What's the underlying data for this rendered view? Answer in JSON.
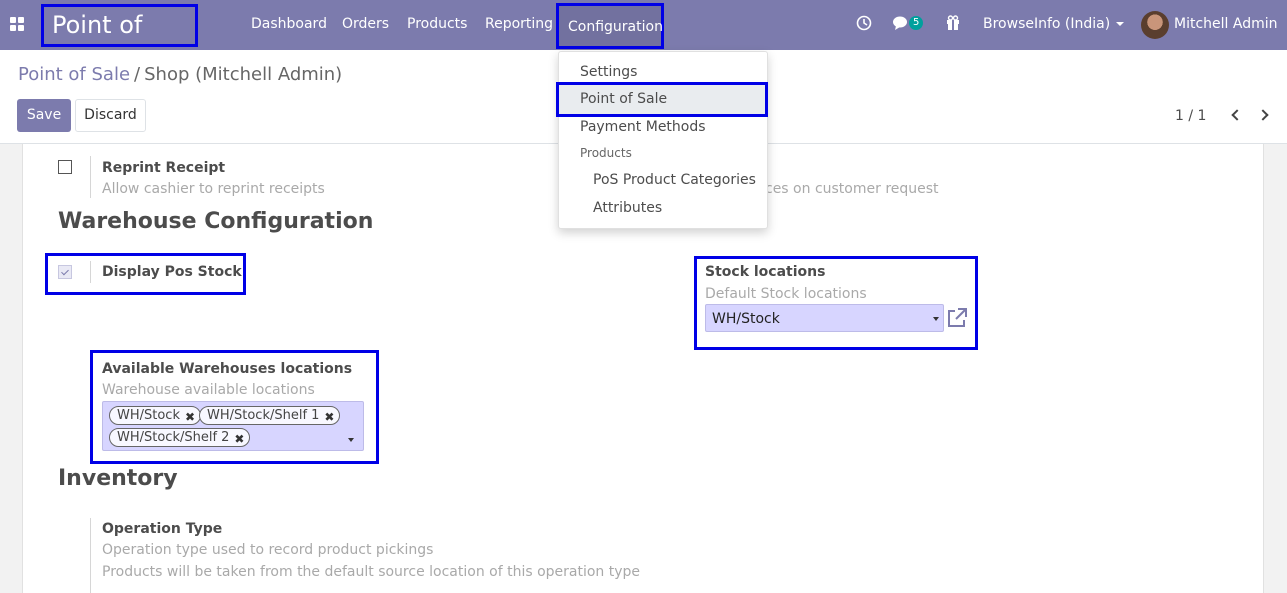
{
  "navbar": {
    "brand": "Point of Sale",
    "menu": [
      "Dashboard",
      "Orders",
      "Products",
      "Reporting"
    ],
    "active_menu": "Configuration",
    "chat_badge": "5",
    "company": "BrowseInfo (India)",
    "user": "Mitchell Admin",
    "icons": [
      "apps-icon",
      "clock-icon",
      "chat-icon",
      "gift-icon"
    ]
  },
  "breadcrumb": {
    "parent": "Point of Sale",
    "separator": "/",
    "current": "Shop (Mitchell Admin)"
  },
  "buttons": {
    "save": "Save",
    "discard": "Discard"
  },
  "pager": {
    "value": "1 / 1"
  },
  "dropdown": {
    "items": [
      "Settings",
      "Point of Sale",
      "Payment Methods"
    ],
    "section_header": "Products",
    "sub_items": [
      "PoS Product Categories",
      "Attributes"
    ]
  },
  "form": {
    "reprint": {
      "title": "Reprint Receipt",
      "help": "Allow cashier to reprint receipts",
      "checked": false
    },
    "hidden_help_tail": "ces on customer request",
    "warehouse_section": "Warehouse Configuration",
    "display_stock": {
      "title": "Display Pos Stock",
      "checked": true
    },
    "stock_locations": {
      "title": "Stock locations",
      "help": "Default Stock locations",
      "value": "WH/Stock"
    },
    "available_wh": {
      "title": "Available Warehouses locations",
      "help": "Warehouse available locations",
      "tags": [
        "WH/Stock",
        "WH/Stock/Shelf 1",
        "WH/Stock/Shelf 2"
      ]
    },
    "inventory_section": "Inventory",
    "operation_type": {
      "title": "Operation Type",
      "help1": "Operation type used to record product pickings",
      "help2": "Products will be taken from the default source location of this operation type"
    }
  },
  "colors": {
    "navbar": "#7c7bad",
    "highlight": "#0000e6",
    "field_bg": "#d7d5ff"
  }
}
